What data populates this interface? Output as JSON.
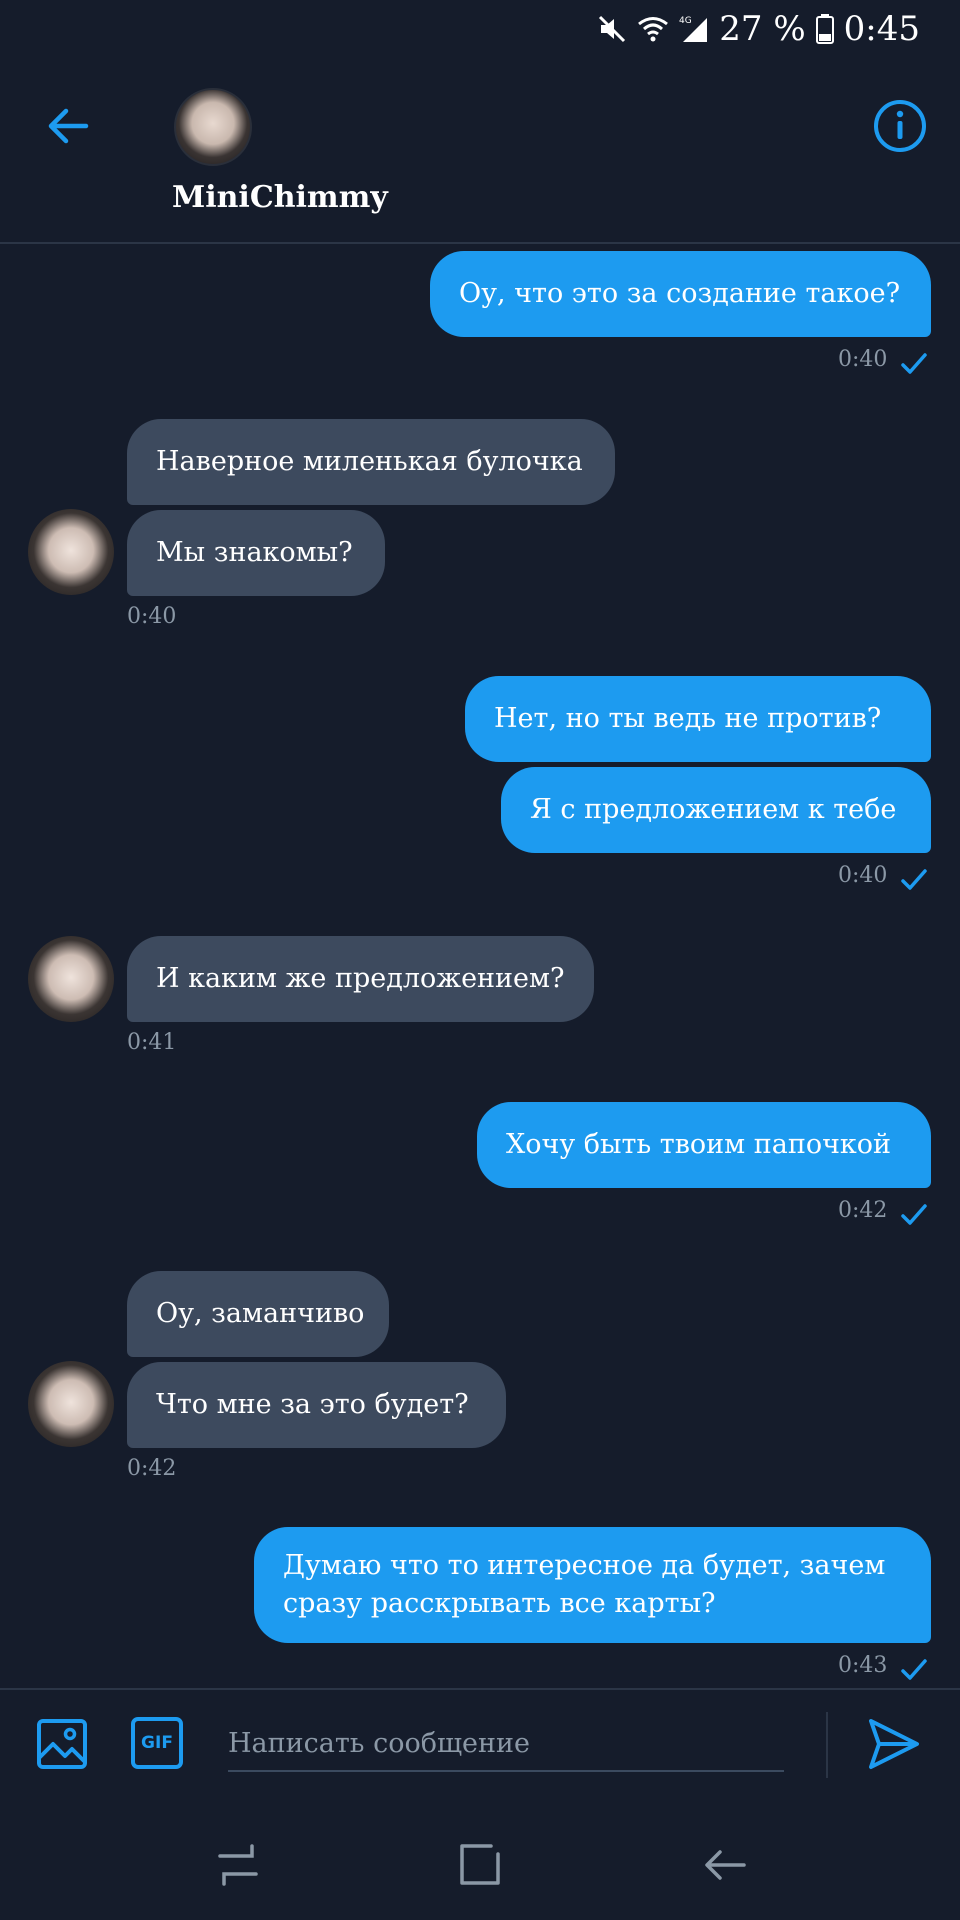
{
  "status_bar": {
    "battery_percent": "27 %",
    "clock": "0:45",
    "network": "4G",
    "icons": [
      "mute-icon",
      "wifi-icon",
      "signal-icon",
      "battery-icon"
    ]
  },
  "header": {
    "contact_name": "MiniChimmy",
    "back_icon": "back-arrow-icon",
    "info_icon": "info-icon"
  },
  "messages": [
    {
      "direction": "out",
      "text": "Оу, что это за создание такое?"
    },
    {
      "direction": "out",
      "time": "0:40",
      "read": true
    },
    {
      "direction": "in",
      "text": "Наверное миленькая булочка"
    },
    {
      "direction": "in",
      "text": "Мы знакомы?"
    },
    {
      "direction": "in",
      "time": "0:40"
    },
    {
      "direction": "out",
      "text": "Нет, но ты ведь не против?"
    },
    {
      "direction": "out",
      "text": "Я с предложением к тебе"
    },
    {
      "direction": "out",
      "time": "0:40",
      "read": true
    },
    {
      "direction": "in",
      "text": "И каким же предложением?"
    },
    {
      "direction": "in",
      "time": "0:41"
    },
    {
      "direction": "out",
      "text": "Хочу быть твоим папочкой"
    },
    {
      "direction": "out",
      "time": "0:42",
      "read": true
    },
    {
      "direction": "in",
      "text": "Оу, заманчиво"
    },
    {
      "direction": "in",
      "text": "Что мне за это будет?"
    },
    {
      "direction": "in",
      "time": "0:42"
    },
    {
      "direction": "out",
      "text": "Думаю что то интересное да будет, зачем сразу расскрывать все карты?"
    },
    {
      "direction": "out",
      "time": "0:43",
      "read": true
    }
  ],
  "composer": {
    "placeholder": "Написать сообщение",
    "gif_label": "GIF"
  },
  "colors": {
    "background": "#151c2b",
    "outgoing_bubble": "#1d9bf0",
    "incoming_bubble": "#3d4a5e",
    "accent": "#1d9bf0",
    "timestamp": "#8b98a6"
  }
}
